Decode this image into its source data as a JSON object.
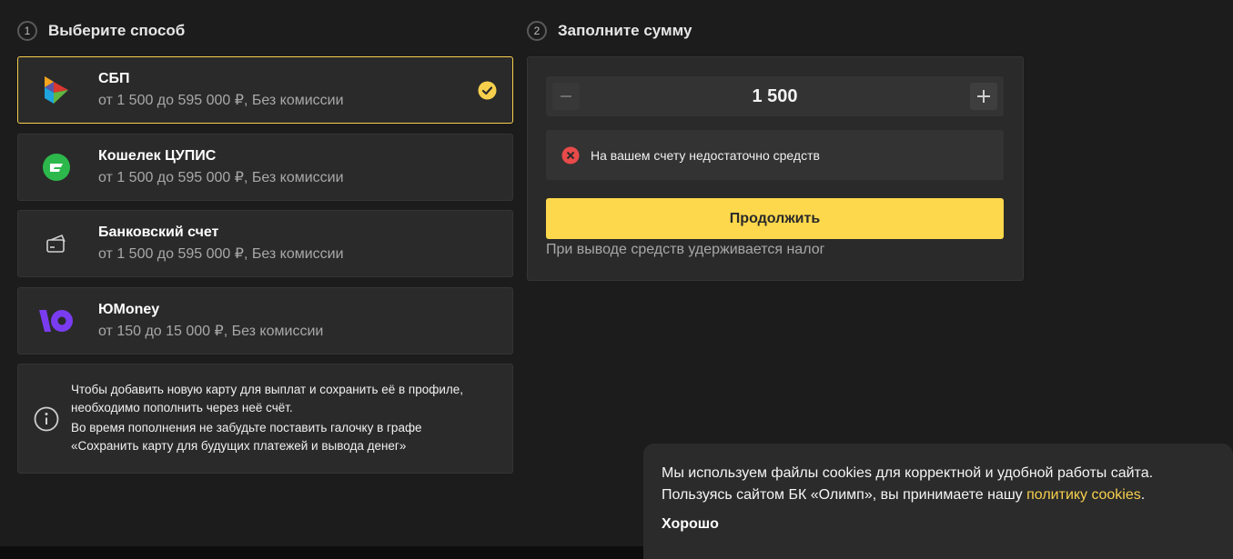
{
  "step1": {
    "number": "1",
    "title": "Выберите способ"
  },
  "step2": {
    "number": "2",
    "title": "Заполните сумму"
  },
  "methods": [
    {
      "title": "СБП",
      "subtitle": "от 1 500 до 595 000 ₽, Без комиссии",
      "icon": "sbp-logo-icon",
      "selected": true
    },
    {
      "title": "Кошелек ЦУПИС",
      "subtitle": "от 1 500 до 595 000 ₽, Без комиссии",
      "icon": "cupis-wallet-icon",
      "selected": false
    },
    {
      "title": "Банковский счет",
      "subtitle": "от 1 500 до 595 000 ₽, Без комиссии",
      "icon": "bank-card-icon",
      "selected": false
    },
    {
      "title": "ЮMoney",
      "subtitle": "от 150 до 15 000 ₽, Без комиссии",
      "icon": "yoomoney-logo-icon",
      "selected": false
    }
  ],
  "info": {
    "line1": "Чтобы добавить новую карту для выплат и сохранить её в профиле, необходимо пополнить через неё счёт.",
    "line2": "Во время пополнения не забудьте поставить галочку в графе «Сохранить карту для будущих платежей и вывода денег»"
  },
  "amount": {
    "value": "1 500",
    "error": "На вашем счету недостаточно средств",
    "continue_label": "Продолжить",
    "tax_note": "При выводе средств удерживается налог"
  },
  "cookie": {
    "text_line1": "Мы используем файлы cookies для корректной и удобной работы сайта.",
    "text_line2_prefix": "Пользуясь сайтом БК «Олимп», вы принимаете нашу ",
    "link_label": "политику cookies",
    "text_line2_suffix": ".",
    "ok_label": "Хорошо"
  },
  "colors": {
    "accent": "#fdd84c",
    "error": "#e84a4a",
    "yoomoney": "#7a3cf0",
    "cupis": "#2db84c"
  }
}
